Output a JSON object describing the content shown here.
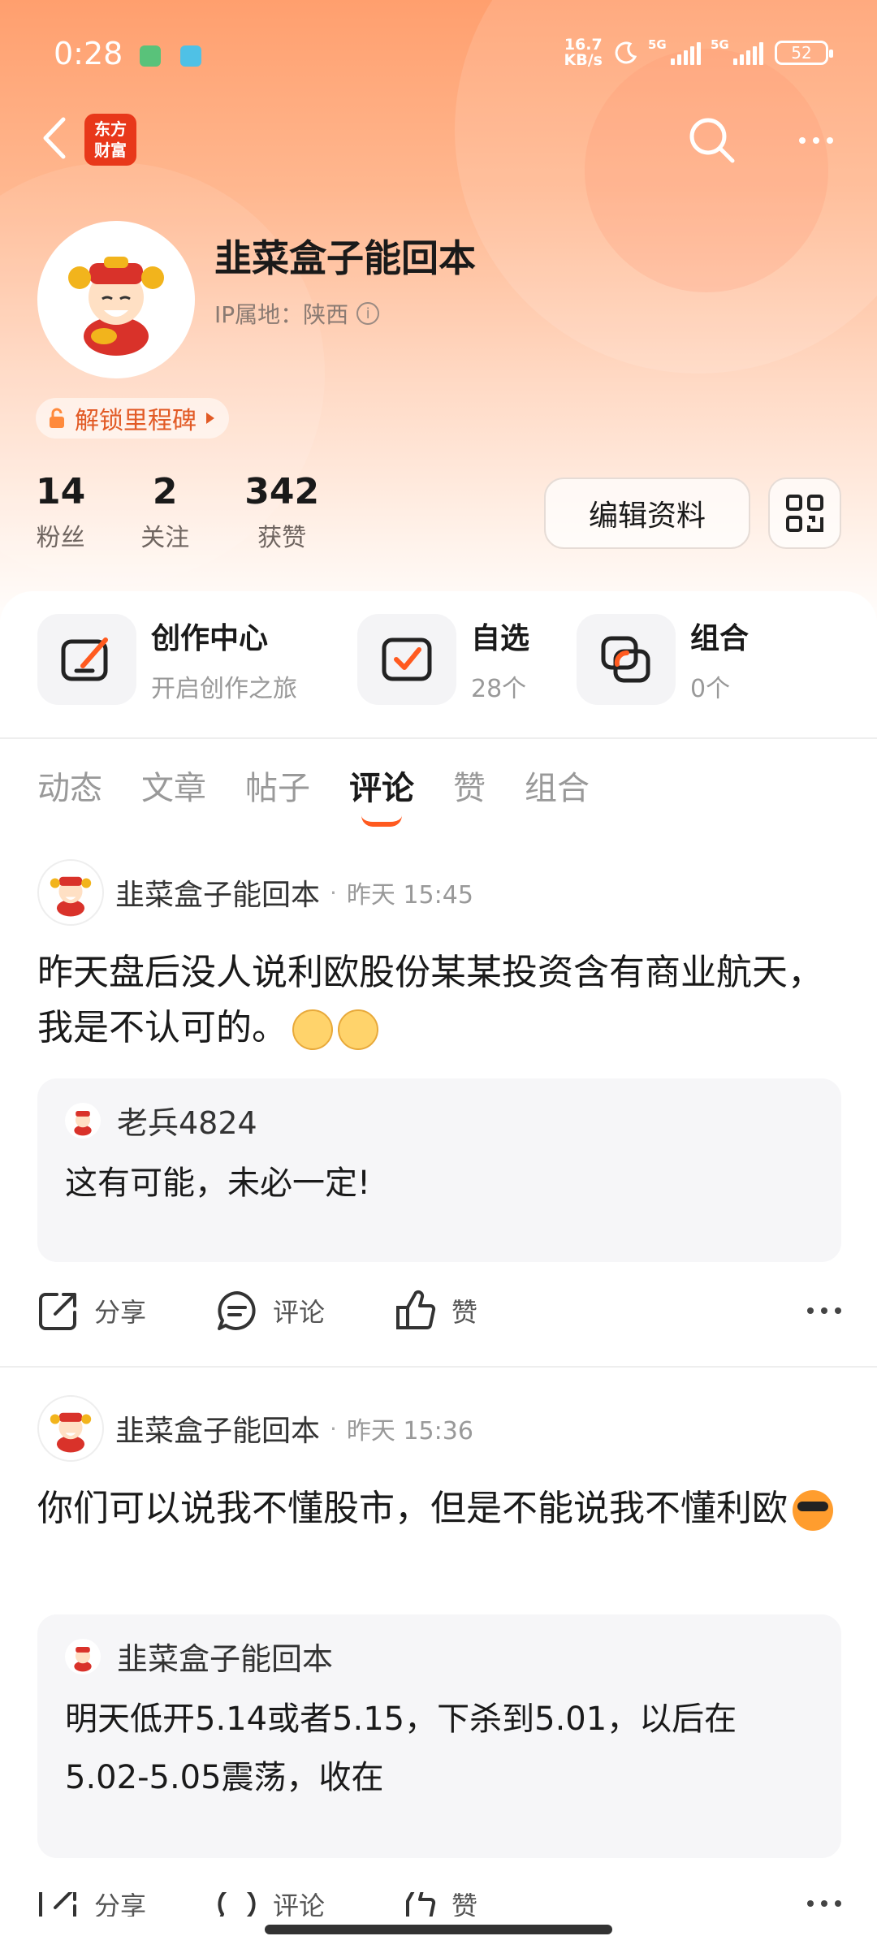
{
  "status_bar": {
    "time": "0:28",
    "net_speed_value": "16.7",
    "net_speed_unit": "KB/s",
    "signal1_label": "5G",
    "signal2_label": "5G",
    "battery": "52"
  },
  "nav": {
    "app_logo_line1": "东方",
    "app_logo_line2": "财富"
  },
  "profile": {
    "username": "韭菜盒子能回本",
    "ip_location": "IP属地：陕西",
    "milestone_label": "解锁里程碑",
    "stats": [
      {
        "value": "14",
        "label": "粉丝"
      },
      {
        "value": "2",
        "label": "关注"
      },
      {
        "value": "342",
        "label": "获赞"
      }
    ],
    "edit_label": "编辑资料"
  },
  "features": [
    {
      "title": "创作中心",
      "subtitle": "开启创作之旅"
    },
    {
      "title": "自选",
      "subtitle": "28个"
    },
    {
      "title": "组合",
      "subtitle": "0个"
    }
  ],
  "tabs": [
    {
      "label": "动态"
    },
    {
      "label": "文章"
    },
    {
      "label": "帖子"
    },
    {
      "label": "评论",
      "active": true
    },
    {
      "label": "赞"
    },
    {
      "label": "组合"
    }
  ],
  "posts": [
    {
      "author": "韭菜盒子能回本",
      "separator": "·",
      "time": "昨天 15:45",
      "body": "昨天盘后没人说利欧股份某某投资含有商业航天，我是不认可的。",
      "quote_author": "老兵4824",
      "quote_text": "这有可能，未必一定!"
    },
    {
      "author": "韭菜盒子能回本",
      "separator": "·",
      "time": "昨天 15:36",
      "body": "你们可以说我不懂股市，但是不能说我不懂利欧",
      "quote_author": "韭菜盒子能回本",
      "quote_text": "明天低开5.14或者5.15，下杀到5.01，以后在5.02-5.05震荡，收在"
    }
  ],
  "actions": {
    "share": "分享",
    "comment": "评论",
    "like": "赞"
  },
  "colors": {
    "accent": "#ff5a1f",
    "header_gradient_top": "#ff9f6e",
    "logo_red": "#e8381a"
  }
}
